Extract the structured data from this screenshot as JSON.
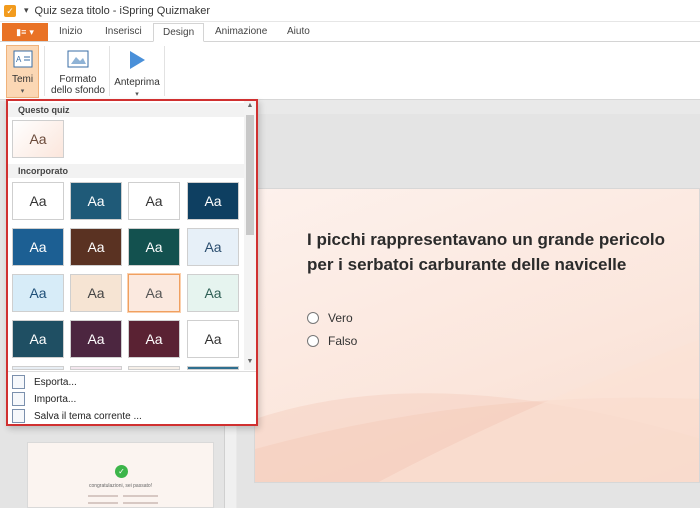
{
  "window": {
    "title": "Quiz seza titolo - iSpring Quizmaker",
    "qa_symbol": "▾ ▪"
  },
  "tabs": [
    {
      "label": "Inizio"
    },
    {
      "label": "Inserisci"
    },
    {
      "label": "Design"
    },
    {
      "label": "Animazione"
    },
    {
      "label": "Aiuto"
    }
  ],
  "ribbon": {
    "temi": "Temi",
    "formato_line1": "Formato",
    "formato_line2": "dello sfondo",
    "anteprima": "Anteprima"
  },
  "dropdown": {
    "section_quiz": "Questo quiz",
    "section_builtin": "Incorporato",
    "sample_text": "Aa",
    "menu": {
      "export": "Esporta...",
      "import": "Importa...",
      "save": "Salva il tema corrente ..."
    },
    "themes": [
      {
        "bg": "#ffffff",
        "fg": "#333333"
      },
      {
        "bg": "#1f5a78",
        "fg": "#ffffff"
      },
      {
        "bg": "#ffffff",
        "fg": "#333333"
      },
      {
        "bg": "#0e3f61",
        "fg": "#ffffff"
      },
      {
        "bg": "#1c5f93",
        "fg": "#ffffff"
      },
      {
        "bg": "#5a3222",
        "fg": "#ffffff"
      },
      {
        "bg": "#13514f",
        "fg": "#ffffff"
      },
      {
        "bg": "#e7f0f8",
        "fg": "#2a4d6e"
      },
      {
        "bg": "#d7ecf8",
        "fg": "#1f4f78"
      },
      {
        "bg": "#f6e4d3",
        "fg": "#444444"
      },
      {
        "bg": "#fbe9df",
        "fg": "#555555"
      },
      {
        "bg": "#e6f4ef",
        "fg": "#2e5f55"
      },
      {
        "bg": "#1f4f63",
        "fg": "#ffffff"
      },
      {
        "bg": "#4c2640",
        "fg": "#ffffff"
      },
      {
        "bg": "#5a2233",
        "fg": "#ffffff"
      },
      {
        "bg": "#ffffff",
        "fg": "#333333"
      }
    ]
  },
  "slide": {
    "question": "I picchi rappresentavano un grande pericolo per i serbatoi carburante delle navicelle",
    "options": [
      "Vero",
      "Falso"
    ]
  },
  "thumbnail": {
    "text": "congratulazioni, sei passato!"
  }
}
